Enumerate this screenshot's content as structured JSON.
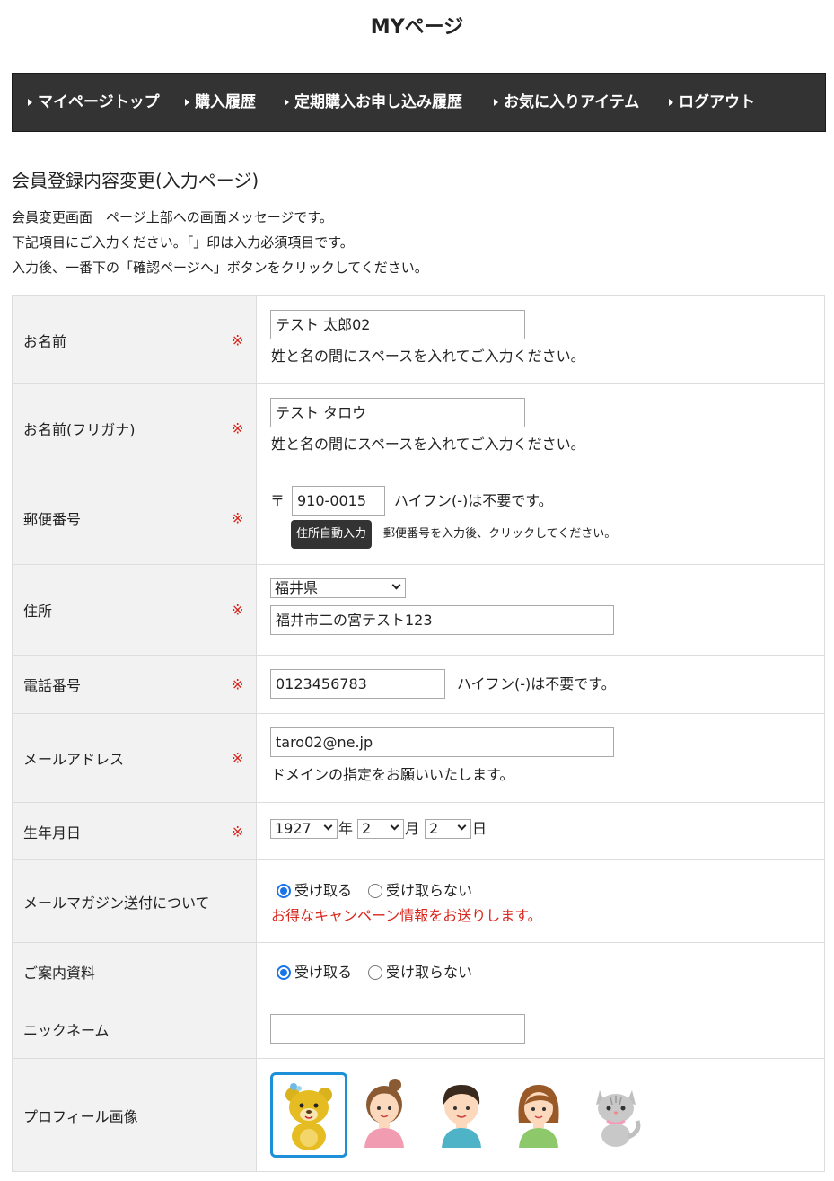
{
  "page": {
    "title": "MYページ"
  },
  "nav": {
    "items": [
      {
        "label": "マイページトップ"
      },
      {
        "label": "購入履歴"
      },
      {
        "label": "定期購入お申し込み履歴"
      },
      {
        "label": "お気に入りアイテム"
      },
      {
        "label": "ログアウト"
      }
    ]
  },
  "section": {
    "title": "会員登録内容変更(入力ページ)",
    "intro": [
      "会員変更画面　ページ上部への画面メッセージです。",
      "下記項目にご入力ください。「」印は入力必須項目です。",
      "入力後、一番下の「確認ページへ」ボタンをクリックしてください。"
    ]
  },
  "required_mark": "※",
  "form": {
    "name": {
      "label": "お名前",
      "value": "テスト 太郎02",
      "note": "姓と名の間にスペースを入れてご入力ください。"
    },
    "kana": {
      "label": "お名前(フリガナ)",
      "value": "テスト タロウ",
      "note": "姓と名の間にスペースを入れてご入力ください。"
    },
    "zip": {
      "label": "郵便番号",
      "prefix": "〒",
      "value": "910-0015",
      "note": "ハイフン(-)は不要です。",
      "button": "住所自動入力",
      "button_note": "郵便番号を入力後、クリックしてください。"
    },
    "address": {
      "label": "住所",
      "prefecture": "福井県",
      "value": "福井市二の宮テスト123"
    },
    "phone": {
      "label": "電話番号",
      "value": "0123456783",
      "note": "ハイフン(-)は不要です。"
    },
    "email": {
      "label": "メールアドレス",
      "value": "taro02@ne.jp",
      "note": "ドメインの指定をお願いいたします。"
    },
    "birthday": {
      "label": "生年月日",
      "year": "1927",
      "year_unit": "年",
      "month": "2",
      "month_unit": "月",
      "day": "2",
      "day_unit": "日"
    },
    "magazine": {
      "label": "メールマガジン送付について",
      "opt_yes": "受け取る",
      "opt_no": "受け取らない",
      "selected": "yes",
      "note": "お得なキャンペーン情報をお送りします。"
    },
    "brochure": {
      "label": "ご案内資料",
      "opt_yes": "受け取る",
      "opt_no": "受け取らない",
      "selected": "yes"
    },
    "nickname": {
      "label": "ニックネーム",
      "value": ""
    },
    "profile_image": {
      "label": "プロフィール画像",
      "options": [
        "bear",
        "girl",
        "boy",
        "woman",
        "cat"
      ],
      "selected": "bear"
    }
  },
  "colors": {
    "nav_bg": "#333333",
    "required": "#d9261c",
    "label_bg": "#f2f2f2",
    "radio": "#1a73e8",
    "avatar_selected": "#1e90d8"
  }
}
